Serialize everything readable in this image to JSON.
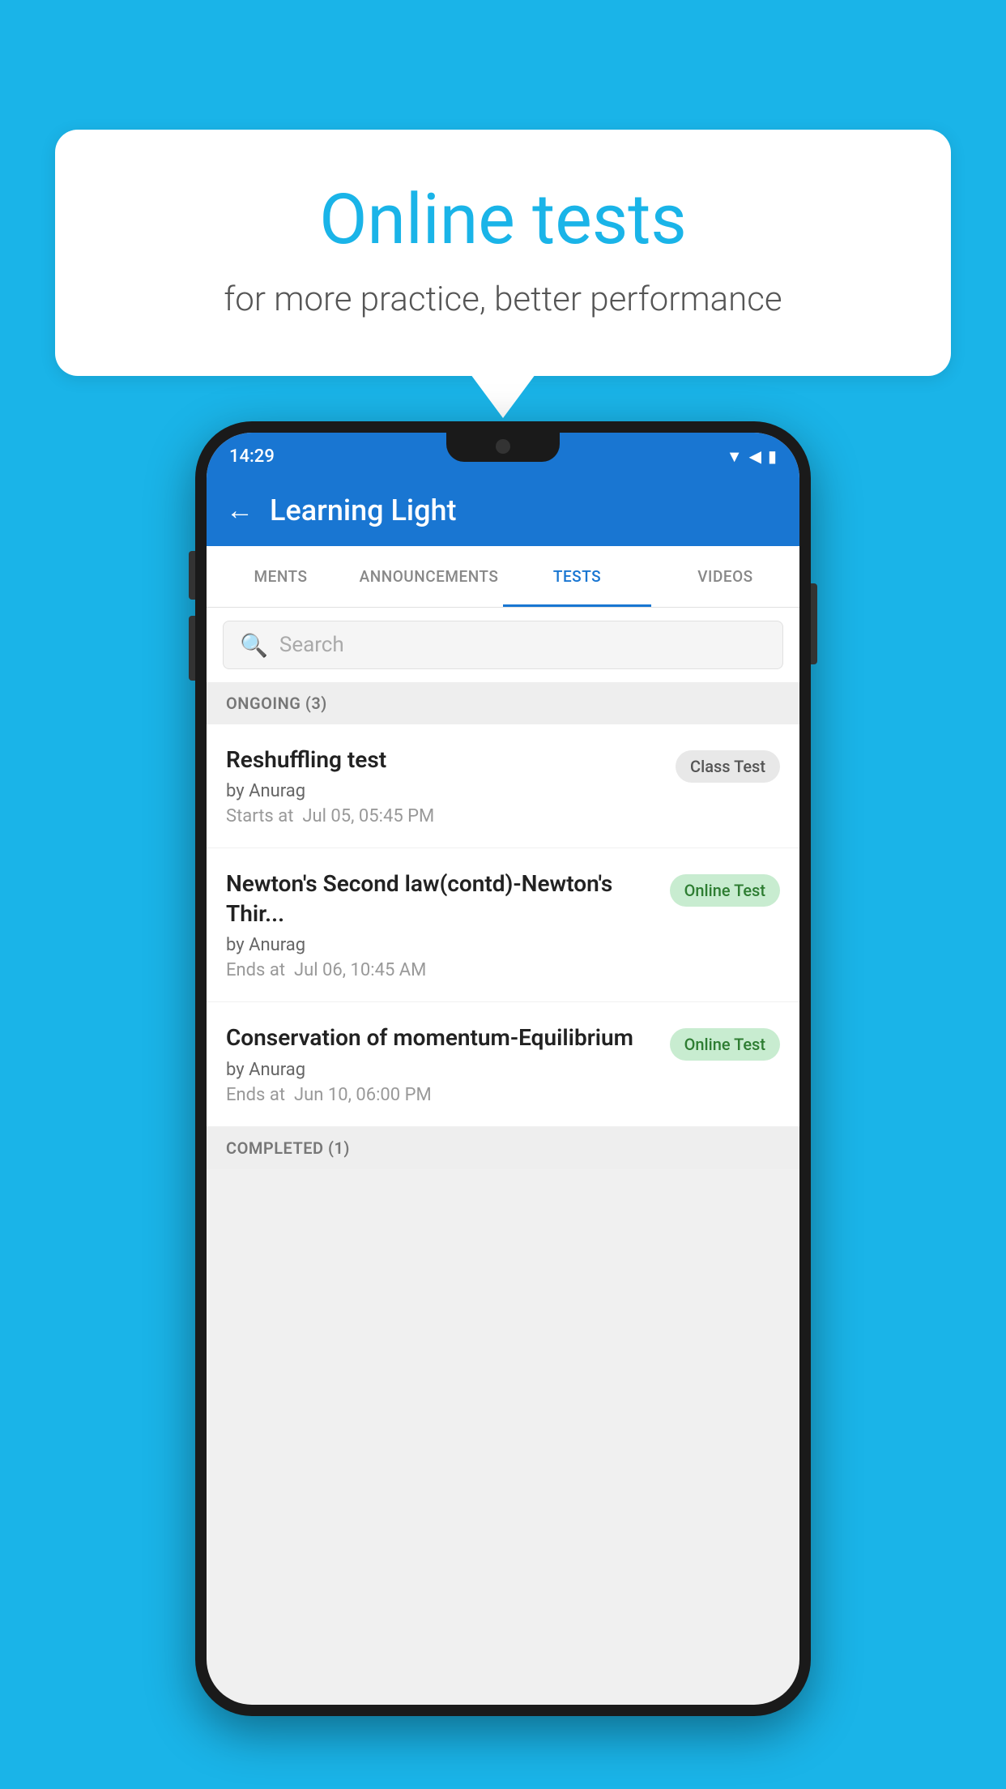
{
  "background": {
    "color": "#1ab4e8"
  },
  "speech_bubble": {
    "title": "Online tests",
    "subtitle": "for more practice, better performance"
  },
  "phone": {
    "status_bar": {
      "time": "14:29",
      "icons": [
        "wifi",
        "signal",
        "battery"
      ]
    },
    "app_bar": {
      "title": "Learning Light",
      "back_label": "←"
    },
    "tabs": [
      {
        "label": "MENTS",
        "active": false
      },
      {
        "label": "ANNOUNCEMENTS",
        "active": false
      },
      {
        "label": "TESTS",
        "active": true
      },
      {
        "label": "VIDEOS",
        "active": false
      }
    ],
    "search": {
      "placeholder": "Search"
    },
    "sections": [
      {
        "label": "ONGOING (3)",
        "tests": [
          {
            "name": "Reshuffling test",
            "author": "by Anurag",
            "time_label": "Starts at",
            "time_value": "Jul 05, 05:45 PM",
            "badge": "Class Test",
            "badge_type": "class"
          },
          {
            "name": "Newton's Second law(contd)-Newton's Thir...",
            "author": "by Anurag",
            "time_label": "Ends at",
            "time_value": "Jul 06, 10:45 AM",
            "badge": "Online Test",
            "badge_type": "online"
          },
          {
            "name": "Conservation of momentum-Equilibrium",
            "author": "by Anurag",
            "time_label": "Ends at",
            "time_value": "Jun 10, 06:00 PM",
            "badge": "Online Test",
            "badge_type": "online"
          }
        ]
      }
    ],
    "completed_section_label": "COMPLETED (1)"
  }
}
